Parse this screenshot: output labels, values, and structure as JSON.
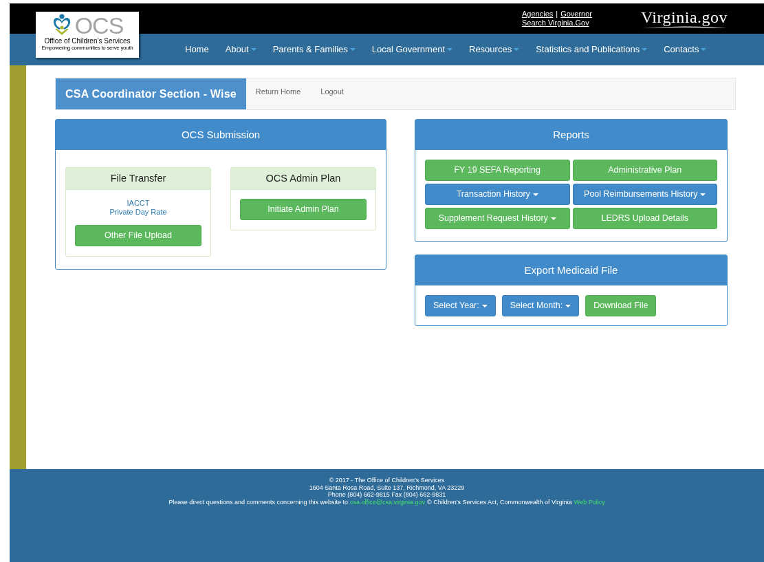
{
  "header": {
    "logo": {
      "mark": "OCS",
      "name": "Office of Children’s Services",
      "tagline": "Empowering communities to serve youth"
    },
    "links": [
      {
        "label": "Agencies"
      },
      {
        "label": "Governor"
      },
      {
        "label": "Search Virginia.Gov"
      }
    ],
    "separator": "|",
    "brand": "Virginia.gov"
  },
  "nav": [
    {
      "label": "Home",
      "dropdown": false
    },
    {
      "label": "About",
      "dropdown": true
    },
    {
      "label": "Parents & Families",
      "dropdown": true
    },
    {
      "label": "Local Government",
      "dropdown": true
    },
    {
      "label": "Resources",
      "dropdown": true
    },
    {
      "label": "Statistics and Publications",
      "dropdown": true
    },
    {
      "label": "Contacts",
      "dropdown": true
    }
  ],
  "section": {
    "title": "CSA Coordinator Section - Wise",
    "links": [
      "Return Home",
      "Logout"
    ]
  },
  "ocs_submission": {
    "title": "OCS Submission",
    "cards": [
      {
        "title": "File Transfer",
        "links": [
          "IACCT",
          "Private Day Rate"
        ],
        "buttons": [
          {
            "label": "Other File Upload",
            "kind": "success",
            "dropdown": false
          }
        ]
      },
      {
        "title": "OCS Admin Plan",
        "buttons": [
          {
            "label": "Initiate Admin Plan",
            "kind": "success",
            "dropdown": false
          }
        ]
      }
    ]
  },
  "reports": {
    "title": "Reports",
    "buttons": [
      {
        "label": "FY 19 SEFA Reporting",
        "kind": "success",
        "dropdown": false
      },
      {
        "label": "Administrative Plan",
        "kind": "success",
        "dropdown": false
      },
      {
        "label": "Transaction History",
        "kind": "primary",
        "dropdown": true
      },
      {
        "label": "Pool Reimbursements History",
        "kind": "primary",
        "dropdown": true
      },
      {
        "label": "Supplement Request History",
        "kind": "success",
        "dropdown": true
      },
      {
        "label": "LEDRS Upload Details",
        "kind": "success",
        "dropdown": false
      }
    ]
  },
  "export": {
    "title": "Export Medicaid File",
    "buttons": [
      {
        "label": "Select Year:",
        "kind": "primary",
        "dropdown": true
      },
      {
        "label": "Select Month:",
        "kind": "primary",
        "dropdown": true
      },
      {
        "label": "Download File",
        "kind": "success",
        "dropdown": false
      }
    ]
  },
  "footer": {
    "lines": [
      "© 2017 - The Office of Children's Services",
      "1604 Santa Rosa Road, Suite 137, Richmond, VA 23229",
      "Phone (804) 662-9815  Fax (804) 662-9831"
    ],
    "contact": {
      "text_before": "Please direct questions and comments concerning this website to",
      "email": "csa.office@csa.virginia.gov",
      "text_after": "© Children's Services Act, Commonwealth of Virginia",
      "policy_link": "Web Policy"
    }
  }
}
